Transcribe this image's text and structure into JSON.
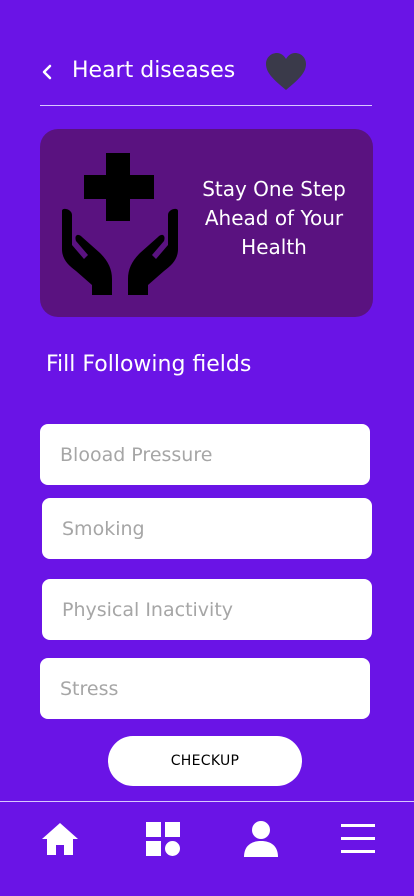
{
  "header": {
    "title": "Heart diseases"
  },
  "banner": {
    "text": "Stay One Step Ahead of Your Health"
  },
  "form": {
    "title": "Fill Following fields",
    "fields": [
      {
        "placeholder": "Blooad Pressure",
        "value": ""
      },
      {
        "placeholder": "Smoking",
        "value": ""
      },
      {
        "placeholder": "Physical Inactivity",
        "value": ""
      },
      {
        "placeholder": "Stress",
        "value": ""
      }
    ],
    "submit_label": "CHECKUP"
  },
  "nav": {
    "items": [
      {
        "icon": "home-icon"
      },
      {
        "icon": "grid-icon"
      },
      {
        "icon": "user-icon"
      },
      {
        "icon": "menu-icon"
      }
    ]
  },
  "colors": {
    "background": "#6a14e6",
    "banner": "#5a1280",
    "heart": "#3a3a4a",
    "field": "#ffffff"
  }
}
